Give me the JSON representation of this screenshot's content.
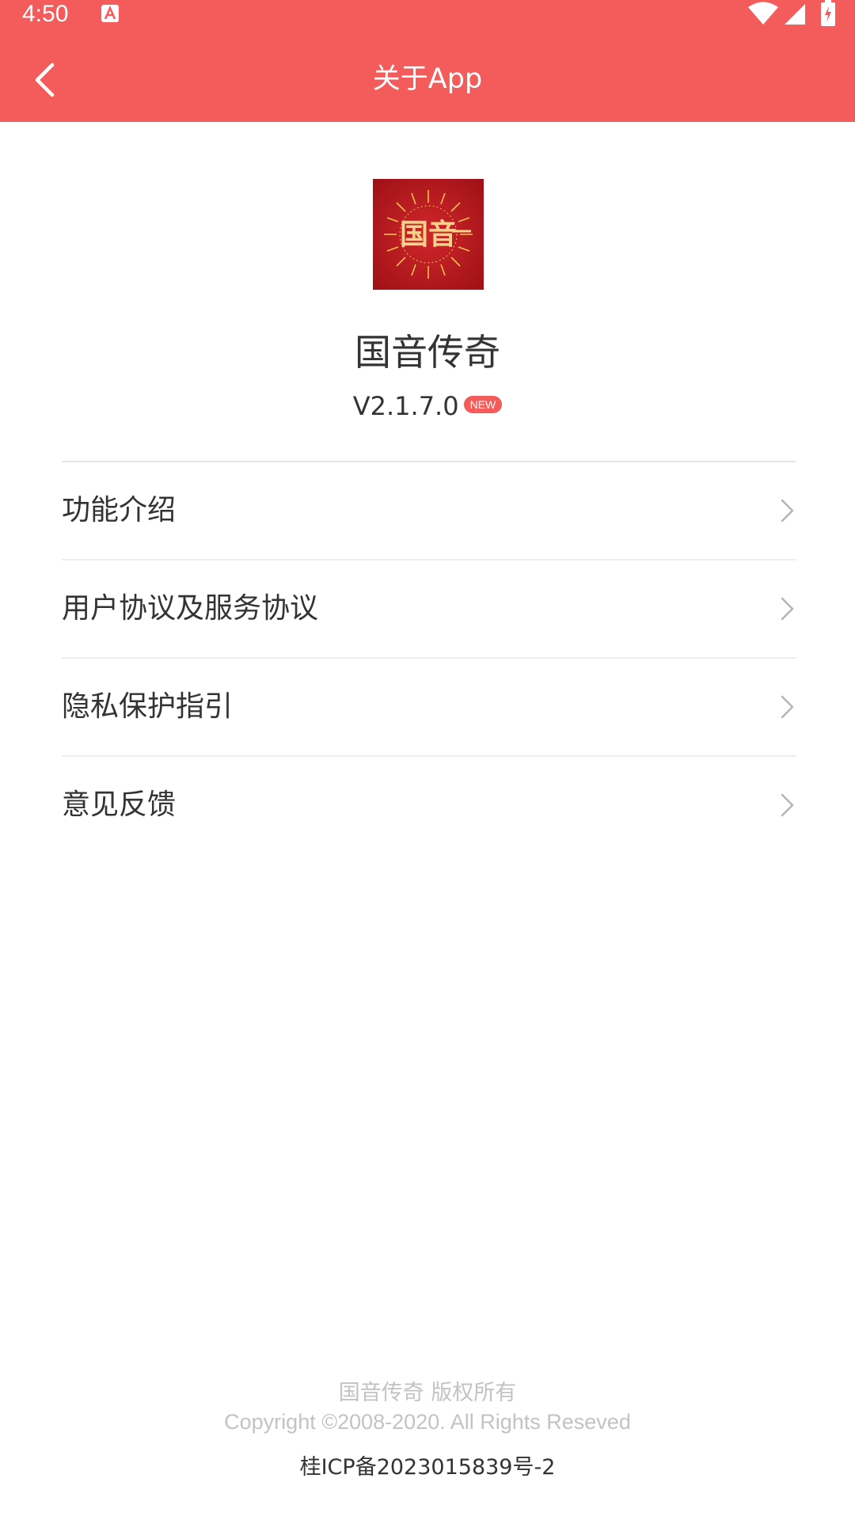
{
  "status_bar": {
    "time": "4:50"
  },
  "app_bar": {
    "title": "关于App",
    "back_icon": "chevron-left-icon"
  },
  "app_info": {
    "name": "国音传奇",
    "version": "V2.1.7.0",
    "badge": "NEW",
    "logo_text": "国音"
  },
  "menu": {
    "items": [
      {
        "label": "功能介绍"
      },
      {
        "label": "用户协议及服务协议"
      },
      {
        "label": "隐私保护指引"
      },
      {
        "label": "意见反馈"
      }
    ]
  },
  "footer": {
    "owner": "国音传奇 版权所有",
    "copyright": "Copyright ©2008-2020. All Rights Reseved",
    "icp": "桂ICP备2023015839号-2"
  },
  "colors": {
    "header": "#F45B5B",
    "badge": "#F45B5B",
    "logo_bg": "#B3161B",
    "logo_gold": "#F2C14E"
  }
}
